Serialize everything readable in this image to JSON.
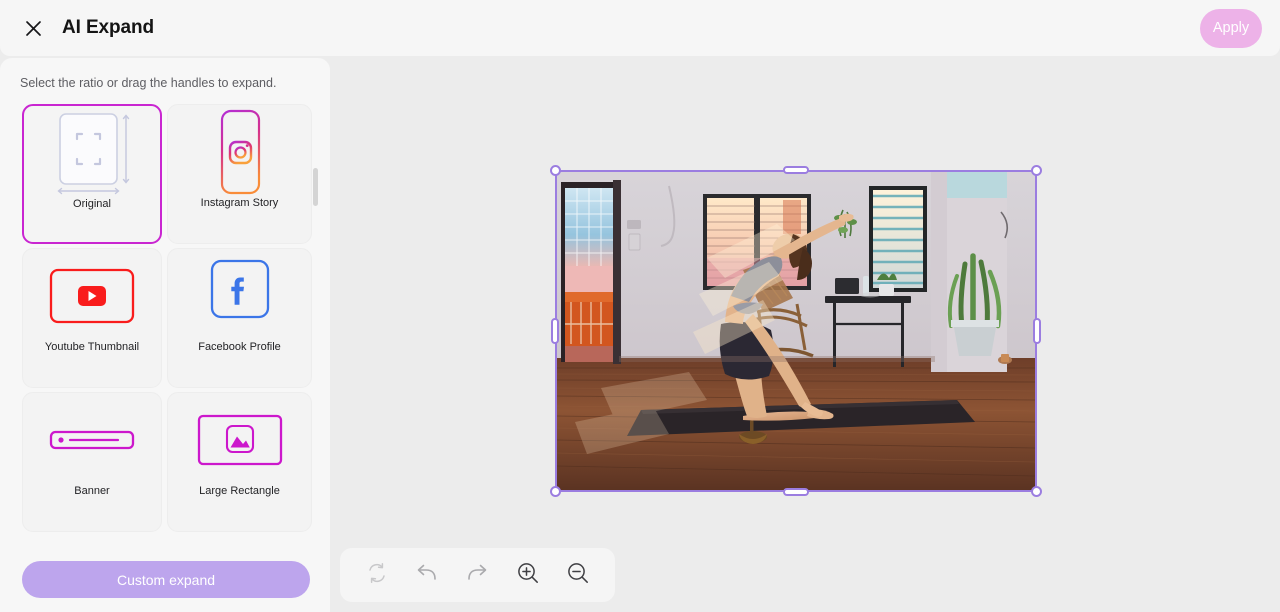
{
  "header": {
    "title": "AI Expand",
    "close_icon": "close-icon",
    "apply_label": "Apply",
    "apply_disabled": true
  },
  "sidebar": {
    "hint": "Select the ratio or drag the handles to expand.",
    "custom_expand_label": "Custom expand",
    "ratios": [
      {
        "label": "Original",
        "icon": "original-frame-icon",
        "selected": true,
        "accent": "#c4c7de"
      },
      {
        "label": "Instagram Story",
        "icon": "instagram-icon",
        "selected": false,
        "accent": "#d62976"
      },
      {
        "label": "Youtube Thumbnail",
        "icon": "youtube-icon",
        "selected": false,
        "accent": "#ff0000"
      },
      {
        "label": "Facebook Profile",
        "icon": "facebook-icon",
        "selected": false,
        "accent": "#3b75e8"
      },
      {
        "label": "Banner",
        "icon": "banner-icon",
        "selected": false,
        "accent": "#cc17cc"
      },
      {
        "label": "Large Rectangle",
        "icon": "large-rectangle-icon",
        "selected": false,
        "accent": "#cc17cc"
      }
    ]
  },
  "toolbar": {
    "buttons": [
      {
        "name": "reset-icon",
        "label": "Reset",
        "disabled": true
      },
      {
        "name": "undo-icon",
        "label": "Undo",
        "disabled": false
      },
      {
        "name": "redo-icon",
        "label": "Redo",
        "disabled": false
      },
      {
        "name": "zoom-in-icon",
        "label": "Zoom in",
        "disabled": false
      },
      {
        "name": "zoom-out-icon",
        "label": "Zoom out",
        "disabled": false
      }
    ]
  },
  "canvas": {
    "image_alt": "Woman performing a kneeling backbend yoga pose on a dark mat in a sunlit room with wooden floor",
    "selection_color": "#9b7de0",
    "handles": [
      "top-left",
      "top-center",
      "top-right",
      "middle-left",
      "middle-right",
      "bottom-left",
      "bottom-center",
      "bottom-right"
    ]
  },
  "colors": {
    "selected_border": "#c925d1",
    "apply_bg": "#edb2e8",
    "custom_expand_bg": "#bda5ed",
    "canvas_bg": "#ececec",
    "panel_bg": "#f7f7f7"
  }
}
